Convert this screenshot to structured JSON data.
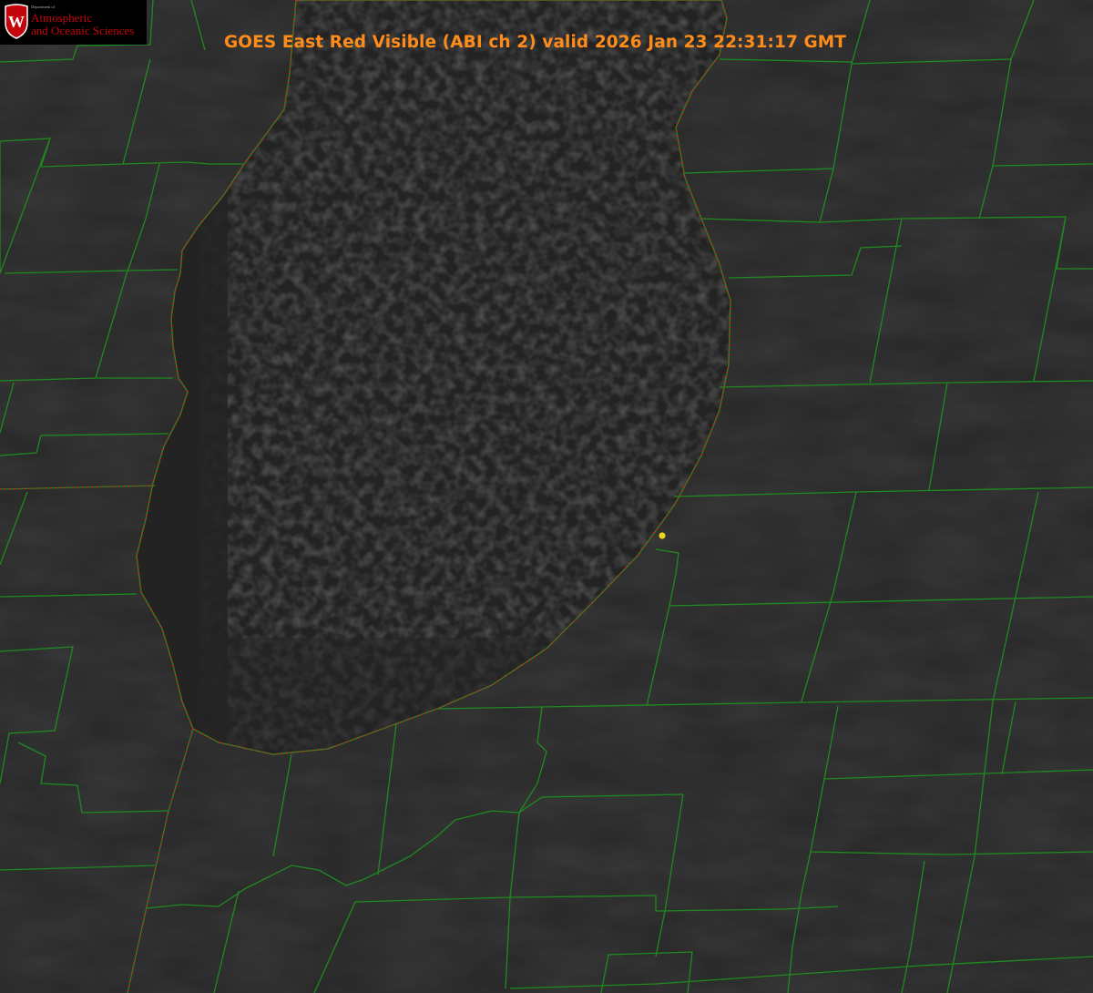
{
  "title": "GOES East Red Visible (ABI ch 2) valid 2026 Jan 23 22:31:17 GMT",
  "logo": {
    "line1": "Department of",
    "line2": "Atmospheric",
    "line3": "and Oceanic Sciences",
    "emblem_letter": "W"
  },
  "colors": {
    "title": "#ff8c1a",
    "county_lines": "#1f8a1f",
    "shoreline_dotted": "#d02020",
    "marker": "#e8d820",
    "land": "#2a2a2a",
    "lake": "#242424"
  }
}
